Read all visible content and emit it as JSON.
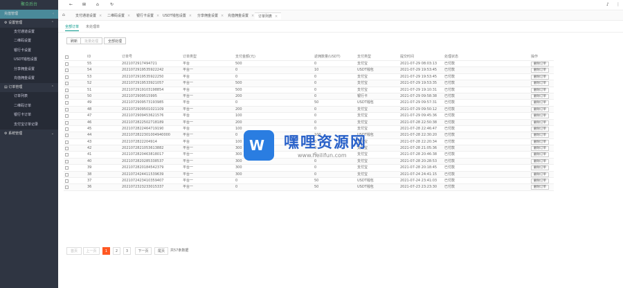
{
  "sidebar": {
    "brand": "聚合后台",
    "groups": [
      {
        "label": "充值管理",
        "active": true
      },
      {
        "label": "设置管理"
      },
      {
        "label": "订单管理"
      },
      {
        "label": "系统管理"
      }
    ],
    "settings_items": [
      "支付通道设置",
      "二维码设置",
      "银行卡设置",
      "USDT钱包设置",
      "分享佣金设置",
      "充值佣金设置"
    ],
    "order_items": [
      "订单列表",
      "二维码订单",
      "银行卡订单",
      "支付宝订单记录"
    ]
  },
  "topbar": {
    "icons": [
      "left-arrow-icon",
      "grid-icon",
      "home-icon",
      "refresh-icon",
      "bell-icon",
      "menu-icon"
    ]
  },
  "tabs": [
    "支付通道设置",
    "二维码设置",
    "银行卡设置",
    "USDT钱包设置",
    "分享佣金设置",
    "充值佣金设置",
    "订单列表"
  ],
  "subtabs": [
    "全部订单",
    "未处理单"
  ],
  "actions": {
    "refresh": "刷新",
    "batch_process": "批量处理",
    "batch_delete": "全部处理"
  },
  "table": {
    "columns": [
      "ID",
      "订单号",
      "订单类型",
      "支付金额(元)",
      "返佣数量(USDT)",
      "支付类型",
      "提交时间",
      "处理状态",
      "操作"
    ],
    "rows": [
      {
        "id": "55",
        "order": "2021072917494721",
        "type": "平台",
        "amount": "500",
        "usdt": "0",
        "pay": "支付宝",
        "time": "2021-07-29 08:03:13",
        "status": "已付款",
        "op": "删除订单"
      },
      {
        "id": "54",
        "order": "2021072919535922242",
        "type": "平台一",
        "amount": "0",
        "usdt": "10",
        "pay": "USDT钱包",
        "time": "2021-07-29 19:53:45",
        "status": "已付款",
        "op": "删除订单"
      },
      {
        "id": "53",
        "order": "2021072919535922250",
        "type": "平台",
        "amount": "0",
        "usdt": "0",
        "pay": "支付宝",
        "time": "2021-07-29 19:53:45",
        "status": "已付款",
        "op": "删除订单"
      },
      {
        "id": "52",
        "order": "2021072919533921057",
        "type": "平台一",
        "amount": "500",
        "usdt": "0",
        "pay": "支付宝",
        "time": "2021-07-29 19:53:35",
        "status": "已付款",
        "op": "删除订单"
      },
      {
        "id": "51",
        "order": "2021072919103198854",
        "type": "平台",
        "amount": "500",
        "usdt": "0",
        "pay": "支付宝",
        "time": "2021-07-29 19:10:31",
        "status": "已付款",
        "op": "删除订单"
      },
      {
        "id": "50",
        "order": "2021072909515995",
        "type": "平台一",
        "amount": "200",
        "usdt": "0",
        "pay": "银行卡",
        "time": "2021-07-29 09:58:38",
        "status": "已付款",
        "op": "删除订单"
      },
      {
        "id": "49",
        "order": "2021072909573193985",
        "type": "平台",
        "amount": "0",
        "usdt": "50",
        "pay": "USDT钱包",
        "time": "2021-07-29 09:57:31",
        "status": "已付款",
        "op": "删除订单"
      },
      {
        "id": "48",
        "order": "2021072909501021109",
        "type": "平台一",
        "amount": "200",
        "usdt": "0",
        "pay": "支付宝",
        "time": "2021-07-29 09:50:12",
        "status": "已付款",
        "op": "删除订单"
      },
      {
        "id": "47",
        "order": "2021072909453621576",
        "type": "平台",
        "amount": "100",
        "usdt": "0",
        "pay": "支付宝",
        "time": "2021-07-29 09:45:36",
        "status": "已付款",
        "op": "删除订单"
      },
      {
        "id": "46",
        "order": "2021072822502718189",
        "type": "平台一",
        "amount": "200",
        "usdt": "0",
        "pay": "支付宝",
        "time": "2021-07-28 22:50:38",
        "status": "已付款",
        "op": "删除订单"
      },
      {
        "id": "45",
        "order": "2021072822464719190",
        "type": "平台",
        "amount": "100",
        "usdt": "0",
        "pay": "支付宝",
        "time": "2021-07-28 22:46:47",
        "status": "已付款",
        "op": "删除订单"
      },
      {
        "id": "44",
        "order": "2021072822301004940000",
        "type": "平台一",
        "amount": "0",
        "usdt": "100",
        "pay": "USDT钱包",
        "time": "2021-07-28 22:30:20",
        "status": "已付款",
        "op": "删除订单"
      },
      {
        "id": "43",
        "order": "2021072822204914",
        "type": "平台",
        "amount": "100",
        "usdt": "0",
        "pay": "支付宝",
        "time": "2021-07-28 22:20:34",
        "status": "已付款",
        "op": "删除订单"
      },
      {
        "id": "42",
        "order": "2021072821053613882",
        "type": "平台一",
        "amount": "300",
        "usdt": "0",
        "pay": "支付宝",
        "time": "2021-07-28 21:05:36",
        "status": "已付款",
        "op": "删除订单"
      },
      {
        "id": "41",
        "order": "2021072820463818017",
        "type": "平台一",
        "amount": "300",
        "usdt": "0",
        "pay": "支付宝",
        "time": "2021-07-28 20:46:38",
        "status": "已付款",
        "op": "删除订单"
      },
      {
        "id": "40",
        "order": "2021072820285338537",
        "type": "平台一",
        "amount": "300",
        "usdt": "0",
        "pay": "支付宝",
        "time": "2021-07-28 20:28:53",
        "status": "已付款",
        "op": "删除订单"
      },
      {
        "id": "39",
        "order": "2021072820184542379",
        "type": "平台一",
        "amount": "300",
        "usdt": "0",
        "pay": "支付宝",
        "time": "2021-07-28 20:18:45",
        "status": "已付款",
        "op": "删除订单"
      },
      {
        "id": "38",
        "order": "2021072424411539639",
        "type": "平台一",
        "amount": "300",
        "usdt": "0",
        "pay": "支付宝",
        "time": "2021-07-24 24:41:15",
        "status": "已付款",
        "op": "删除订单"
      },
      {
        "id": "37",
        "order": "2021072423410359407",
        "type": "平台一",
        "amount": "0",
        "usdt": "50",
        "pay": "USDT钱包",
        "time": "2021-07-24 23:41:03",
        "status": "已付款",
        "op": "删除订单"
      },
      {
        "id": "36",
        "order": "2021072323233015337",
        "type": "平台一",
        "amount": "0",
        "usdt": "50",
        "pay": "USDT钱包",
        "time": "2021-07-23 23:23:30",
        "status": "已付款",
        "op": "删除订单"
      }
    ]
  },
  "pagination": {
    "first": "首页",
    "prev": "上一页",
    "pages": [
      "1",
      "2",
      "3"
    ],
    "current": "1",
    "next": "下一页",
    "last": "尾页",
    "info": "共57条数据"
  },
  "watermark": {
    "title": "嘿哩资源网",
    "url": "www.heilifun.com"
  }
}
